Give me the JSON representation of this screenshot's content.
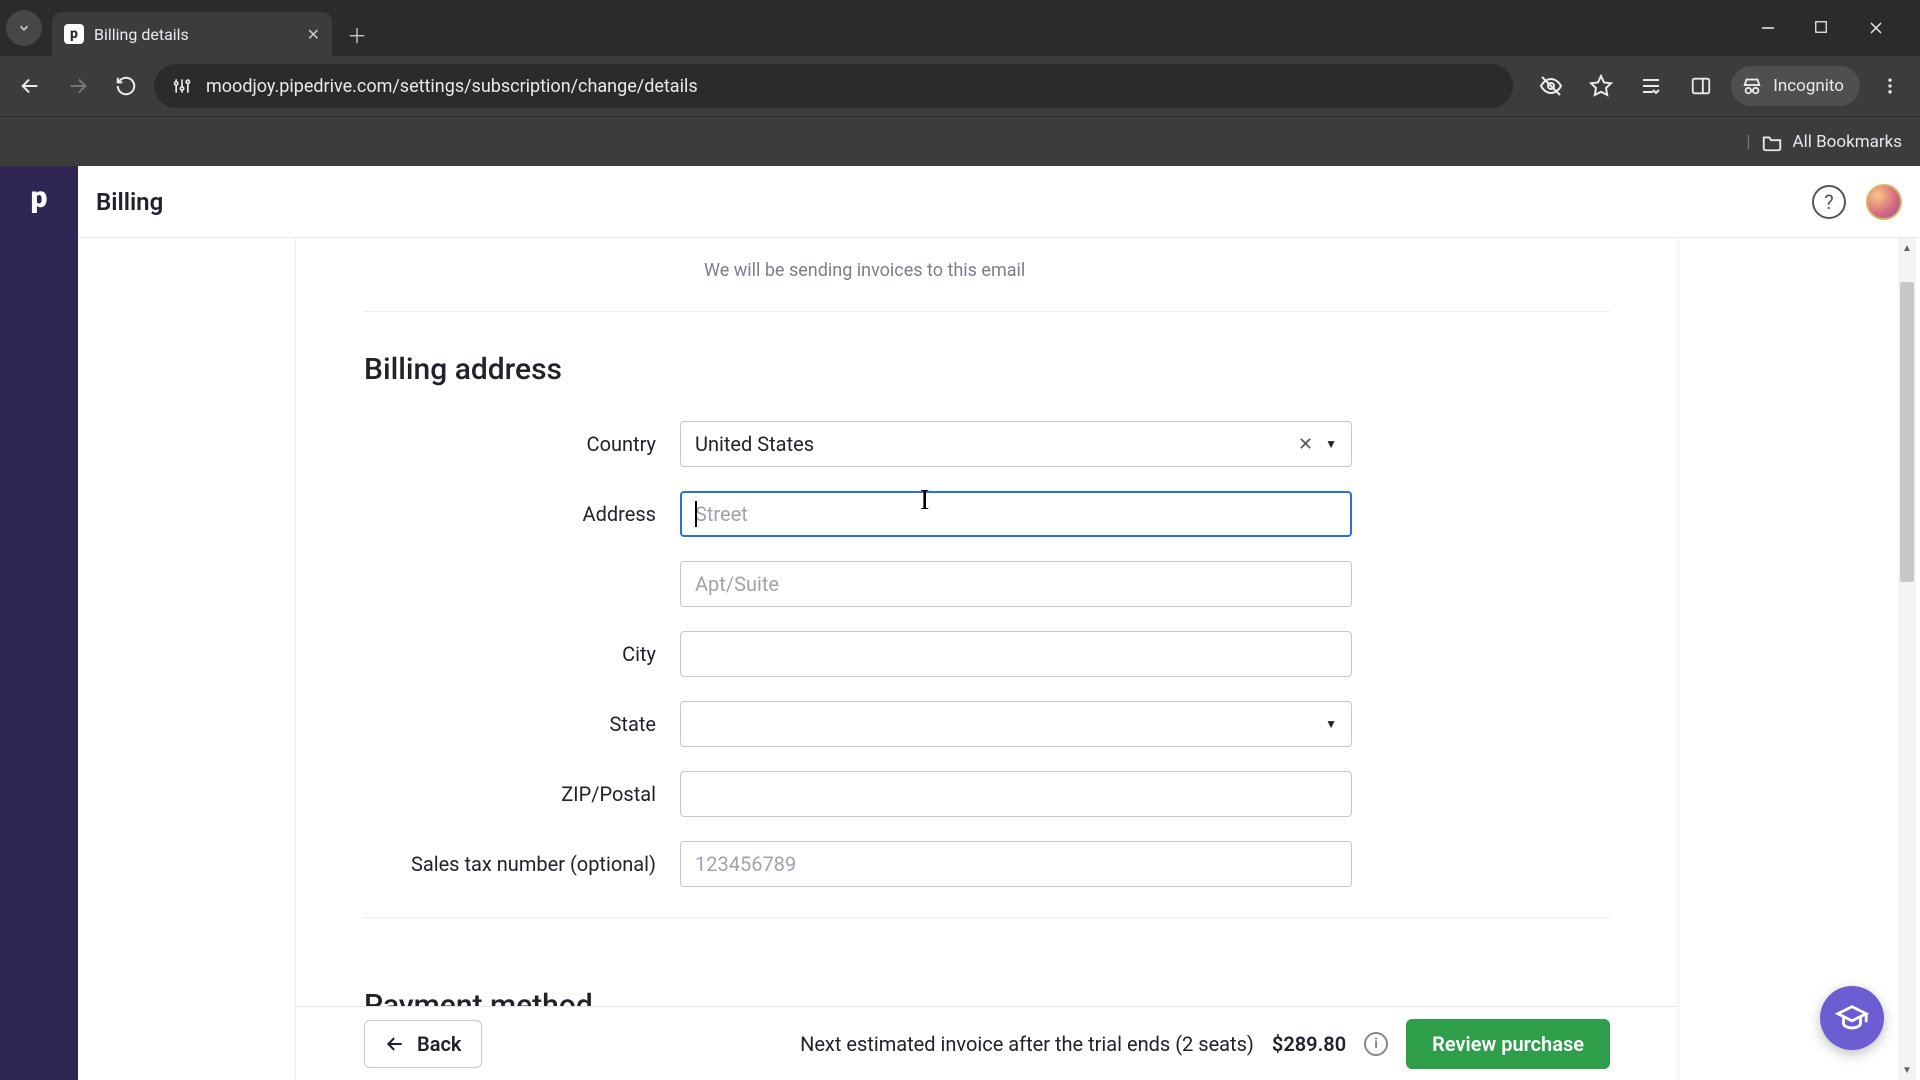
{
  "browser": {
    "tab_title": "Billing details",
    "url": "moodjoy.pipedrive.com/settings/subscription/change/details",
    "incognito_label": "Incognito",
    "all_bookmarks": "All Bookmarks"
  },
  "header": {
    "title": "Billing"
  },
  "email_helper": "We will be sending invoices to this email",
  "section_billing_address": "Billing address",
  "section_payment_method": "Payment method",
  "form": {
    "country": {
      "label": "Country",
      "value": "United States"
    },
    "address": {
      "label": "Address",
      "placeholder_street": "Street",
      "placeholder_apt": "Apt/Suite"
    },
    "city": {
      "label": "City"
    },
    "state": {
      "label": "State"
    },
    "zip": {
      "label": "ZIP/Postal"
    },
    "tax": {
      "label": "Sales tax number (optional)",
      "placeholder": "123456789"
    }
  },
  "bottom_bar": {
    "back": "Back",
    "invoice_text": "Next estimated invoice after the trial ends (2 seats)",
    "invoice_amount": "$289.80",
    "review": "Review purchase"
  }
}
